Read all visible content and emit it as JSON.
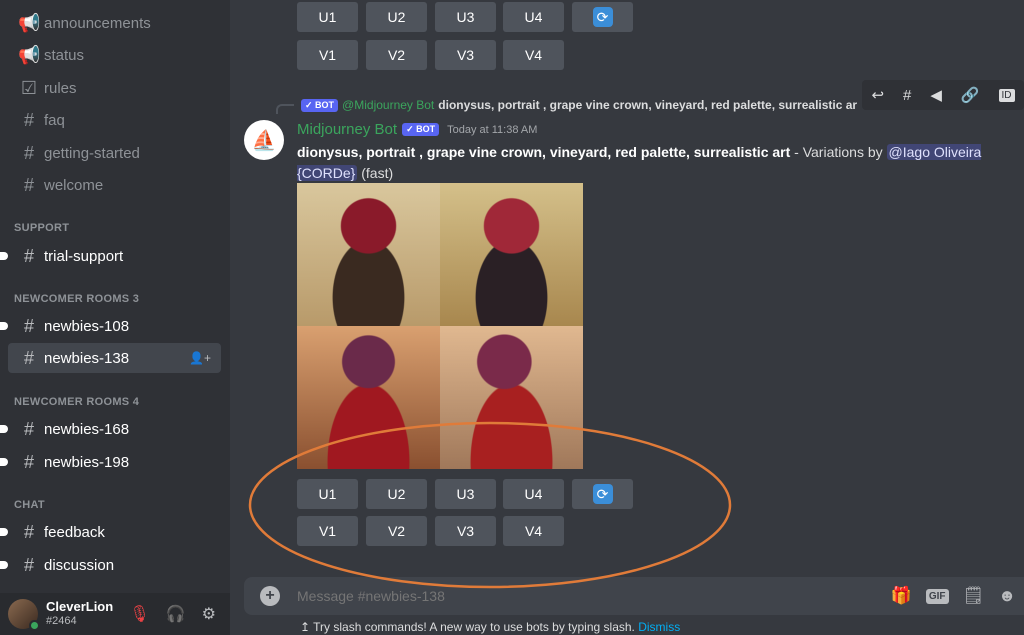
{
  "sidebar": {
    "channels": [
      {
        "name": "announcements",
        "icon": "megaphone-icon",
        "glyph": "📢"
      },
      {
        "name": "status",
        "icon": "megaphone-icon",
        "glyph": "📢"
      },
      {
        "name": "rules",
        "icon": "checkbox-icon",
        "glyph": "☑"
      },
      {
        "name": "faq",
        "icon": "hash-icon",
        "glyph": "#"
      },
      {
        "name": "getting-started",
        "icon": "hash-icon",
        "glyph": "#"
      },
      {
        "name": "welcome",
        "icon": "hash-icon",
        "glyph": "#"
      }
    ],
    "categories": {
      "support": "SUPPORT",
      "newcomer3": "NEWCOMER ROOMS 3",
      "newcomer4": "NEWCOMER ROOMS 4",
      "chat": "CHAT"
    },
    "support": [
      {
        "name": "trial-support"
      }
    ],
    "newcomer3": [
      {
        "name": "newbies-108"
      },
      {
        "name": "newbies-138",
        "selected": true
      }
    ],
    "newcomer4": [
      {
        "name": "newbies-168"
      },
      {
        "name": "newbies-198"
      }
    ],
    "chat": [
      {
        "name": "feedback"
      },
      {
        "name": "discussion"
      }
    ]
  },
  "user": {
    "name": "CleverLion",
    "tag": "#2464"
  },
  "prev_buttons": {
    "u": [
      "U1",
      "U2",
      "U3",
      "U4"
    ],
    "v": [
      "V1",
      "V2",
      "V3",
      "V4"
    ]
  },
  "message": {
    "reply_author": "@Midjourney Bot",
    "reply_text": "dionysus, portrait , grape vine crown, vineyard, red palette, surrealistic art - Variations ...",
    "bot_badge": "✓ BOT",
    "author": "Midjourney Bot",
    "timestamp": "Today at 11:38 AM",
    "prompt": "dionysus, portrait , grape vine crown, vineyard, red palette, surrealistic art",
    "middle": " - Variations by ",
    "mention": "@Iago Oliveira {CORDe}",
    "suffix": " (fast)",
    "buttons": {
      "u": [
        "U1",
        "U2",
        "U3",
        "U4"
      ],
      "v": [
        "V1",
        "V2",
        "V3",
        "V4"
      ]
    }
  },
  "composer": {
    "placeholder": "Message #newbies-138"
  },
  "hint": {
    "text": "Try slash commands! A new way to use bots by typing slash.",
    "dismiss": "Dismiss"
  },
  "colors": {
    "accent": "#5865f2",
    "bot_name": "#3ba55d",
    "annotation": "#e07b39"
  }
}
